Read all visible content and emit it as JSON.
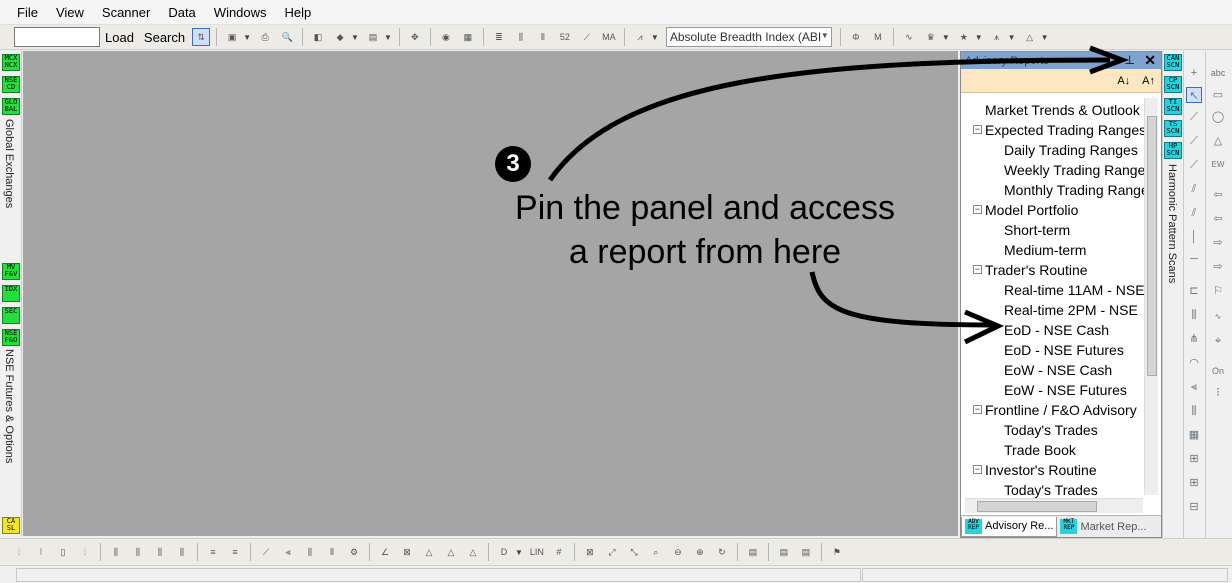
{
  "menu": [
    "File",
    "View",
    "Scanner",
    "Data",
    "Windows",
    "Help"
  ],
  "toolbar": {
    "search_value": "",
    "load_label": "Load",
    "search_label": "Search",
    "indicator_select": "Absolute Breadth Index (ABI"
  },
  "left_strip": {
    "tabs_top": [
      "MCX NCX",
      "NSE CD",
      "GLO BAL"
    ],
    "label_top": "Global Exchanges",
    "tabs_bottom": [
      "MV F&V",
      "IDX",
      "SEC",
      "NSE F&O"
    ],
    "label_bottom": "NSE Futures & Options",
    "tab_bottom_extra": "CA SL"
  },
  "panel": {
    "title": "Advisory Reports",
    "font_smaller": "A↓",
    "font_larger": "A↑",
    "tree": [
      {
        "label": "Market Trends & Outlook",
        "level": 0,
        "expandable": false
      },
      {
        "label": "Expected Trading Ranges",
        "level": 0,
        "expandable": true
      },
      {
        "label": "Daily Trading Ranges",
        "level": 1
      },
      {
        "label": "Weekly Trading Ranges",
        "level": 1
      },
      {
        "label": "Monthly Trading Ranges",
        "level": 1
      },
      {
        "label": "Model Portfolio",
        "level": 0,
        "expandable": true
      },
      {
        "label": "Short-term",
        "level": 1
      },
      {
        "label": "Medium-term",
        "level": 1
      },
      {
        "label": "Trader's Routine",
        "level": 0,
        "expandable": true
      },
      {
        "label": "Real-time 11AM - NSE",
        "level": 1
      },
      {
        "label": "Real-time 2PM - NSE",
        "level": 1
      },
      {
        "label": "EoD - NSE Cash",
        "level": 1
      },
      {
        "label": "EoD - NSE Futures",
        "level": 1
      },
      {
        "label": "EoW - NSE Cash",
        "level": 1
      },
      {
        "label": "EoW - NSE Futures",
        "level": 1
      },
      {
        "label": "Frontline / F&O Advisory",
        "level": 0,
        "expandable": true
      },
      {
        "label": "Today's Trades",
        "level": 1
      },
      {
        "label": "Trade Book",
        "level": 1
      },
      {
        "label": "Investor's Routine",
        "level": 0,
        "expandable": true
      },
      {
        "label": "Today's Trades",
        "level": 1
      }
    ],
    "tabs": [
      {
        "icon": "ADV REP",
        "label": "Advisory Re..."
      },
      {
        "icon": "MKT REP",
        "label": "Market Rep..."
      }
    ]
  },
  "right_strip": {
    "tabs": [
      "CAN SCN",
      "CP SCN",
      "TI SCN",
      "TS SCN",
      "HP SCN"
    ],
    "label": "Harmonic Pattern Scans"
  },
  "annotation": {
    "step": "3",
    "line1": "Pin the panel and access",
    "line2": "a report from here"
  },
  "colors": {
    "workspace": "#a5a5a5",
    "panel_title": "#7fa3cf",
    "font_bar": "#fde6c2",
    "green_tab": "#21e03a",
    "cyan_tab": "#22d3e0"
  }
}
